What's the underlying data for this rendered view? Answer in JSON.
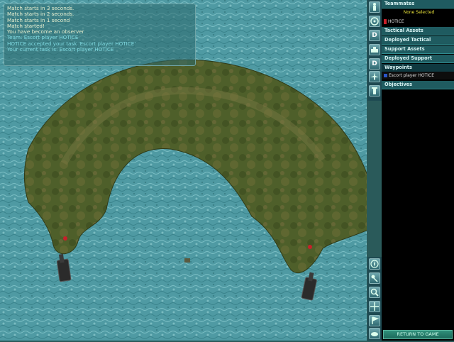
{
  "chat": {
    "lines": [
      "Match starts in 3 seconds.",
      "Match starts in 2 seconds.",
      "Match starts in 1 second",
      "Match started!",
      "You have become an observer",
      "Team: Escort player HOTICE",
      "HOTICE accepted your task 'Escort player HOTICE'",
      "Your current task is: Escort player HOTICE"
    ]
  },
  "panel": {
    "teammates_label": "Teammates",
    "none_selected": "None Selected",
    "player_name": "HOTICE",
    "tactical_assets": "Tactical Assets",
    "deployed_tactical": "Deployed Tactical",
    "support_assets": "Support Assets",
    "deployed_support": "Deployed Support",
    "waypoints": "Waypoints",
    "waypoint_item": "Escort player HOTICE",
    "objectives": "Objectives"
  },
  "toolbar": {
    "d_label": "D"
  },
  "return_button": "RETURN TO GAME",
  "colors": {
    "water": "#4f9aa3",
    "island": "#4e5f2a",
    "panel_header": "#1f5b60",
    "accent_yellow": "#e8e23a"
  },
  "icons": [
    "soldier-icon",
    "circle-target-icon",
    "tank-icon",
    "plane-icon",
    "tower-icon",
    "compass-icon",
    "zoom-icon",
    "move-icon",
    "flag-icon"
  ]
}
